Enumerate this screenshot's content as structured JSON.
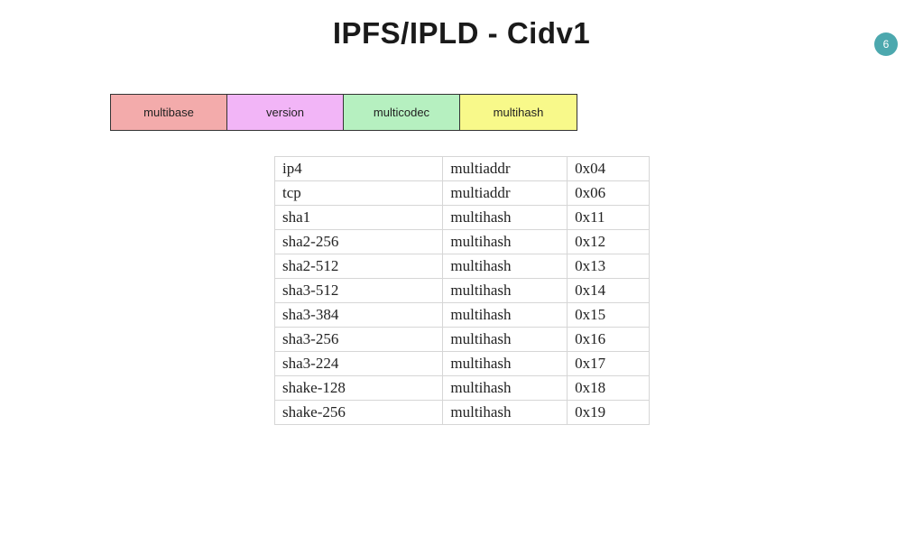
{
  "slide_number": "6",
  "title": "IPFS/IPLD - Cidv1",
  "structure": {
    "cells": [
      "multibase",
      "version",
      "multicodec",
      "multihash"
    ]
  },
  "codec_table": {
    "rows": [
      {
        "name": "ip4",
        "category": "multiaddr",
        "code": "0x04"
      },
      {
        "name": "tcp",
        "category": "multiaddr",
        "code": "0x06"
      },
      {
        "name": "sha1",
        "category": "multihash",
        "code": "0x11"
      },
      {
        "name": "sha2-256",
        "category": "multihash",
        "code": "0x12"
      },
      {
        "name": "sha2-512",
        "category": "multihash",
        "code": "0x13"
      },
      {
        "name": "sha3-512",
        "category": "multihash",
        "code": "0x14"
      },
      {
        "name": "sha3-384",
        "category": "multihash",
        "code": "0x15"
      },
      {
        "name": "sha3-256",
        "category": "multihash",
        "code": "0x16"
      },
      {
        "name": "sha3-224",
        "category": "multihash",
        "code": "0x17"
      },
      {
        "name": "shake-128",
        "category": "multihash",
        "code": "0x18"
      },
      {
        "name": "shake-256",
        "category": "multihash",
        "code": "0x19"
      }
    ]
  }
}
